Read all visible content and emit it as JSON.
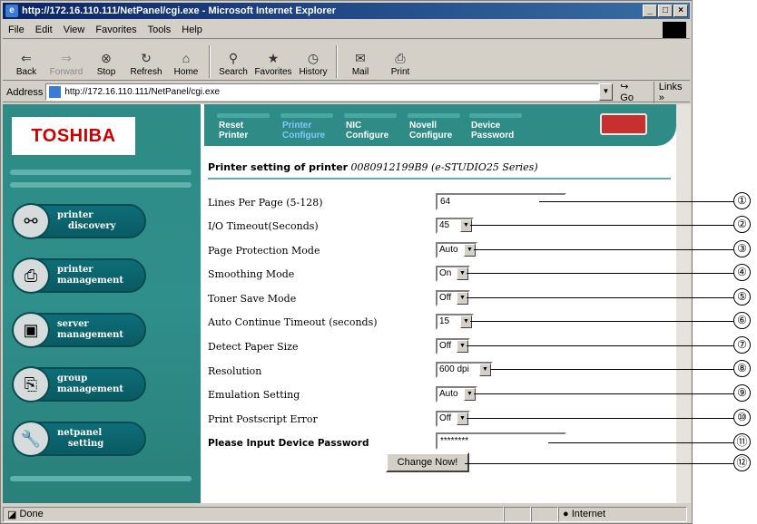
{
  "window": {
    "title": "http://172.16.110.111/NetPanel/cgi.exe - Microsoft Internet Explorer",
    "min": "_",
    "max": "□",
    "close": "×"
  },
  "menu": [
    "File",
    "Edit",
    "View",
    "Favorites",
    "Tools",
    "Help"
  ],
  "toolbar": {
    "back": "Back",
    "forward": "Forward",
    "stop": "Stop",
    "refresh": "Refresh",
    "home": "Home",
    "search": "Search",
    "favorites": "Favorites",
    "history": "History",
    "mail": "Mail",
    "print": "Print"
  },
  "address": {
    "label": "Address",
    "url": "http://172.16.110.111/NetPanel/cgi.exe",
    "go": "Go",
    "links": "Links"
  },
  "logo": "TOSHIBA",
  "sidebar": [
    {
      "line1": "printer",
      "line2": "discovery",
      "icon": "binoculars-icon"
    },
    {
      "line1": "printer",
      "line2": "management",
      "icon": "printer-icon"
    },
    {
      "line1": "server",
      "line2": "management",
      "icon": "computer-icon"
    },
    {
      "line1": "group",
      "line2": "management",
      "icon": "printer-group-icon"
    },
    {
      "line1": "netpanel",
      "line2": "setting",
      "icon": "wrench-icon"
    }
  ],
  "topmenu": [
    {
      "line1": "Reset",
      "line2": "Printer"
    },
    {
      "line1": "Printer",
      "line2": "Configure"
    },
    {
      "line1": "NIC",
      "line2": "Configure"
    },
    {
      "line1": "Novell",
      "line2": "Configure"
    },
    {
      "line1": "Device",
      "line2": "Password"
    }
  ],
  "heading": {
    "bold": "Printer setting of printer",
    "italic": "0080912199B9 (e-STUDIO25 Series)"
  },
  "settings": [
    {
      "label": "Lines Per Page (5-128)",
      "value": "64",
      "type": "text"
    },
    {
      "label": "I/O Timeout(Seconds)",
      "value": "45",
      "type": "select"
    },
    {
      "label": "Page Protection Mode",
      "value": "Auto",
      "type": "select"
    },
    {
      "label": "Smoothing Mode",
      "value": "On",
      "type": "select"
    },
    {
      "label": "Toner Save Mode",
      "value": "Off",
      "type": "select"
    },
    {
      "label": "Auto Continue Timeout (seconds)",
      "value": "15",
      "type": "select"
    },
    {
      "label": "Detect Paper Size",
      "value": "Off",
      "type": "select"
    },
    {
      "label": "Resolution",
      "value": "600 dpi",
      "type": "select"
    },
    {
      "label": "Emulation Setting",
      "value": "Auto",
      "type": "select"
    },
    {
      "label": "Print Postscript Error",
      "value": "Off",
      "type": "select"
    },
    {
      "label": "Please Input Device Password",
      "value": "********",
      "type": "password"
    }
  ],
  "change_button": "Change Now!",
  "callouts": [
    "①",
    "②",
    "③",
    "④",
    "⑤",
    "⑥",
    "⑦",
    "⑧",
    "⑨",
    "⑩",
    "⑪",
    "⑫"
  ],
  "status": {
    "left": "Done",
    "zone": "Internet"
  }
}
